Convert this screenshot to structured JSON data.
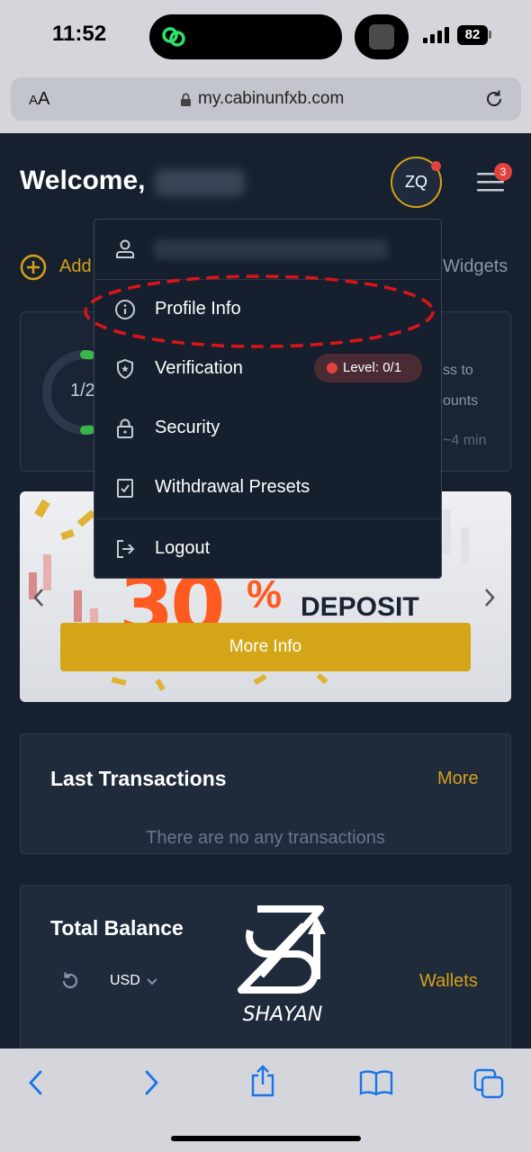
{
  "status_bar": {
    "time": "11:52",
    "battery": "82"
  },
  "browser": {
    "aa_small": "A",
    "aa_large": "A",
    "url": "my.cabinunfxb.com"
  },
  "header": {
    "welcome": "Welcome,",
    "avatar_initials": "ZQ",
    "menu_badge": "3"
  },
  "widgets": {
    "add_label": "Add",
    "widgets_label": "Widgets"
  },
  "progress_card": {
    "ring_text": "1/2",
    "line1": "ss to",
    "line2": "ounts",
    "line3": "~4 min"
  },
  "banner": {
    "percent_number": "30",
    "percent_sign": "%",
    "deposit": "DEPOSIT",
    "more_info": "More Info"
  },
  "transactions": {
    "title": "Last Transactions",
    "more": "More",
    "empty": "There are no any transactions"
  },
  "balance": {
    "title": "Total Balance",
    "currency": "USD",
    "wallets": "Wallets",
    "logo_text": "SHAYAN"
  },
  "dropdown": {
    "items": [
      {
        "label": "Profile Info",
        "icon": "info-icon"
      },
      {
        "label": "Verification",
        "icon": "shield-icon",
        "badge": "Level: 0/1"
      },
      {
        "label": "Security",
        "icon": "lock-icon"
      },
      {
        "label": "Withdrawal Presets",
        "icon": "checklist-icon"
      },
      {
        "label": "Logout",
        "icon": "logout-icon"
      }
    ]
  },
  "colors": {
    "accent": "#d4a017",
    "background": "#16202e",
    "alert": "#e0443c",
    "annotation": "#d9141b"
  }
}
